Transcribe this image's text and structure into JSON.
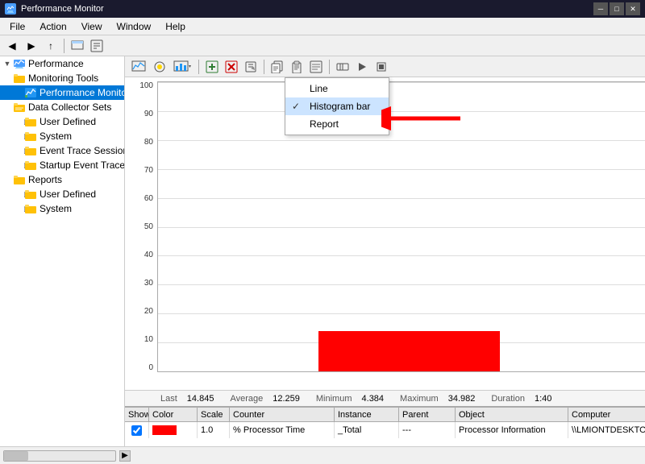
{
  "titleBar": {
    "title": "Performance Monitor",
    "iconLabel": "perf",
    "controls": [
      "minimize",
      "maximize",
      "close"
    ]
  },
  "menuBar": {
    "items": [
      "File",
      "Action",
      "View",
      "Window",
      "Help"
    ]
  },
  "sidebar": {
    "title": "Performance",
    "items": [
      {
        "id": "performance",
        "label": "Performance",
        "level": 0,
        "expanded": true,
        "icon": "computer"
      },
      {
        "id": "monitoring-tools",
        "label": "Monitoring Tools",
        "level": 1,
        "expanded": true,
        "icon": "folder"
      },
      {
        "id": "performance-monitor",
        "label": "Performance Monitor",
        "level": 2,
        "expanded": false,
        "icon": "chart",
        "selected": true
      },
      {
        "id": "data-collector-sets",
        "label": "Data Collector Sets",
        "level": 1,
        "expanded": true,
        "icon": "folder"
      },
      {
        "id": "user-defined",
        "label": "User Defined",
        "level": 2,
        "icon": "folder"
      },
      {
        "id": "system",
        "label": "System",
        "level": 2,
        "icon": "folder"
      },
      {
        "id": "event-trace",
        "label": "Event Trace Sessions",
        "level": 2,
        "icon": "folder"
      },
      {
        "id": "startup-event",
        "label": "Startup Event Trace Sess",
        "level": 2,
        "icon": "folder"
      },
      {
        "id": "reports",
        "label": "Reports",
        "level": 1,
        "expanded": true,
        "icon": "folder"
      },
      {
        "id": "reports-user",
        "label": "User Defined",
        "level": 2,
        "icon": "folder"
      },
      {
        "id": "reports-system",
        "label": "System",
        "level": 2,
        "icon": "folder"
      }
    ]
  },
  "innerToolbar": {
    "buttons": [
      "view",
      "highlight",
      "chart-type",
      "add",
      "delete",
      "properties",
      "sep",
      "copy",
      "paste",
      "report",
      "sep2",
      "freeze",
      "play",
      "stop"
    ]
  },
  "dropdown": {
    "visible": true,
    "items": [
      {
        "id": "line",
        "label": "Line",
        "checked": false
      },
      {
        "id": "histogram",
        "label": "Histogram bar",
        "checked": true
      },
      {
        "id": "report",
        "label": "Report",
        "checked": false
      }
    ]
  },
  "chart": {
    "yLabels": [
      "100",
      "90",
      "80",
      "70",
      "60",
      "50",
      "40",
      "30",
      "20",
      "10",
      "0"
    ],
    "barLeft": "32%",
    "barWidth": "36%",
    "barHeightPct": 14
  },
  "stats": {
    "lastLabel": "Last",
    "lastValue": "14.845",
    "avgLabel": "Average",
    "avgValue": "12.259",
    "minLabel": "Minimum",
    "minValue": "4.384",
    "maxLabel": "Maximum",
    "maxValue": "34.982",
    "durationLabel": "Duration",
    "durationValue": "1:40"
  },
  "counterTable": {
    "headers": [
      "Show",
      "Color",
      "Scale",
      "Counter",
      "Instance",
      "Parent",
      "Object",
      "Computer"
    ],
    "rows": [
      {
        "show": true,
        "colorSwatch": "red",
        "scale": "1.0",
        "counter": "% Processor Time",
        "instance": "_Total",
        "parent": "---",
        "object": "Processor Information",
        "computer": "\\\\LMIONTDESKTOP"
      }
    ]
  },
  "statusBar": {
    "text": ""
  }
}
